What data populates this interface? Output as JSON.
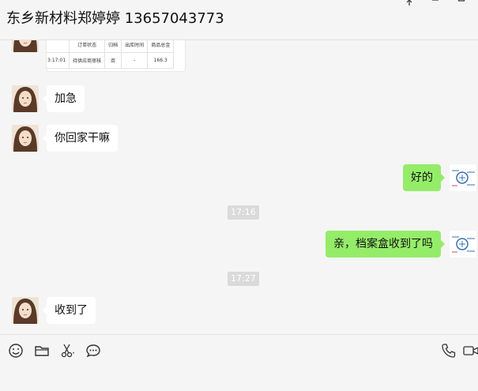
{
  "window": {
    "title": "东乡新材料郑婷婷 13657043773"
  },
  "order_card": {
    "headers": [
      "订单状态",
      "归档",
      "出库时间",
      "商品总金"
    ],
    "row": [
      "3:17:01",
      "待供应商审核",
      "否",
      "-",
      "166.3"
    ]
  },
  "messages": [
    {
      "side": "in",
      "text": "加急"
    },
    {
      "side": "in",
      "text": "你回家干嘛"
    },
    {
      "side": "out",
      "text": "好的"
    },
    {
      "side": "time",
      "text": "17:16"
    },
    {
      "side": "out",
      "text": "亲，档案盒收到了吗"
    },
    {
      "side": "time",
      "text": "17:27"
    },
    {
      "side": "in",
      "text": "收到了"
    }
  ],
  "toolbar": {
    "left_icons": [
      "emoji-icon",
      "folder-icon",
      "scissors-icon",
      "chat-bubble-icon"
    ],
    "right_icons": [
      "phone-icon",
      "video-icon"
    ]
  },
  "colors": {
    "out_bubble": "#95ec69",
    "in_bubble": "#ffffff",
    "background": "#f5f5f5"
  }
}
